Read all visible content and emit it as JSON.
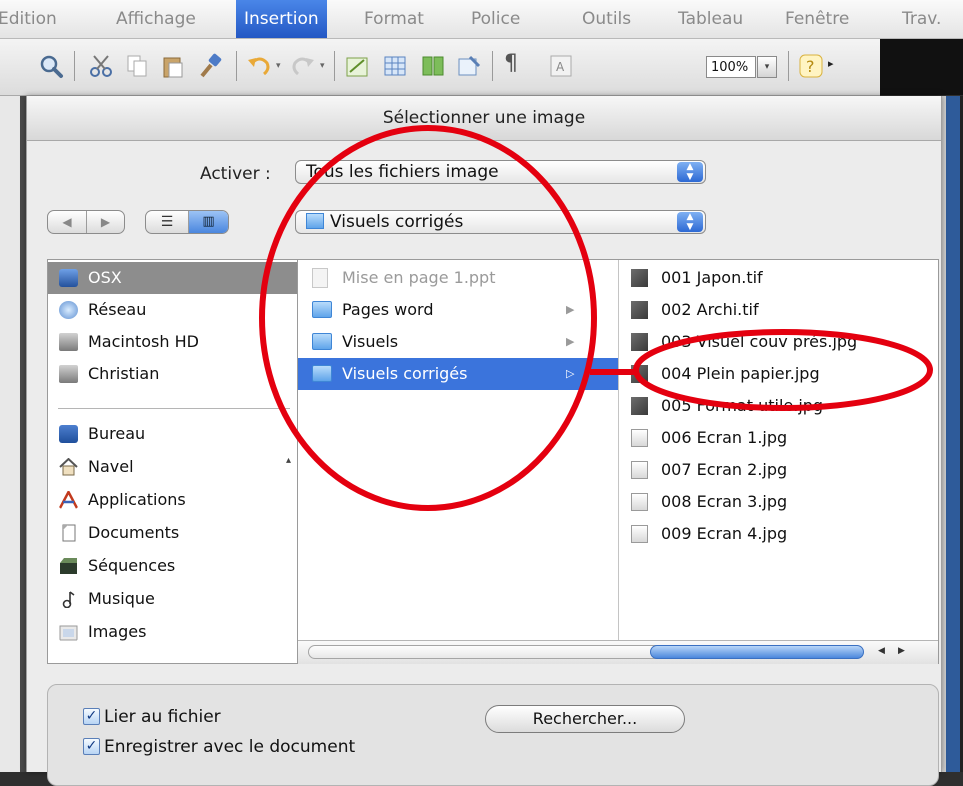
{
  "menubar": {
    "items": [
      {
        "label": "Edition",
        "active": false
      },
      {
        "label": "Affichage",
        "active": false
      },
      {
        "label": "Insertion",
        "active": true
      },
      {
        "label": "Format",
        "active": false
      },
      {
        "label": "Police",
        "active": false
      },
      {
        "label": "Outils",
        "active": false
      },
      {
        "label": "Tableau",
        "active": false
      },
      {
        "label": "Fenêtre",
        "active": false
      },
      {
        "label": "Trav.",
        "active": false
      }
    ]
  },
  "toolbar": {
    "zoom": "100%",
    "icons": [
      "zoom-icon",
      "cut-icon",
      "copy-icon",
      "paste-icon",
      "format-brush-icon",
      "undo-icon",
      "redo-icon",
      "drawing-icon",
      "table-icon",
      "columns-icon",
      "sidebar-icon",
      "pilcrow-icon",
      "text-box-icon",
      "help-icon"
    ]
  },
  "dialog": {
    "title": "Sélectionner une image",
    "activer_label": "Activer :",
    "filter_value": "Tous les fichiers image",
    "location_value": "Visuels corrigés",
    "sidebar": {
      "devices": [
        {
          "label": "OSX",
          "icon": "computer-icon",
          "selected": true
        },
        {
          "label": "Réseau",
          "icon": "network-icon",
          "selected": false
        },
        {
          "label": "Macintosh HD",
          "icon": "hard-drive-icon",
          "selected": false
        },
        {
          "label": "Christian",
          "icon": "hard-drive-icon",
          "selected": false
        }
      ],
      "places": [
        {
          "label": "Bureau",
          "icon": "desktop-icon"
        },
        {
          "label": "Navel",
          "icon": "home-icon"
        },
        {
          "label": "Applications",
          "icon": "applications-icon"
        },
        {
          "label": "Documents",
          "icon": "documents-icon"
        },
        {
          "label": "Séquences",
          "icon": "movies-icon"
        },
        {
          "label": "Musique",
          "icon": "music-icon"
        },
        {
          "label": "Images",
          "icon": "pictures-icon"
        }
      ]
    },
    "column1": [
      {
        "label": "Mise en page 1.ppt",
        "type": "file",
        "dim": true,
        "selected": false
      },
      {
        "label": "Pages word",
        "type": "folder",
        "dim": false,
        "selected": false
      },
      {
        "label": "Visuels",
        "type": "folder",
        "dim": false,
        "selected": false
      },
      {
        "label": "Visuels corrigés",
        "type": "folder",
        "dim": false,
        "selected": true
      }
    ],
    "column2": [
      {
        "label": "001 Japon.tif",
        "thumb": "dark"
      },
      {
        "label": "002 Archi.tif",
        "thumb": "dark"
      },
      {
        "label": "003 Visuel couv prés.jpg",
        "thumb": "dark"
      },
      {
        "label": "004 Plein papier.jpg",
        "thumb": "dark"
      },
      {
        "label": "005 Format utile.jpg",
        "thumb": "dark"
      },
      {
        "label": "006 Ecran 1.jpg",
        "thumb": "light"
      },
      {
        "label": "007 Ecran 2.jpg",
        "thumb": "light"
      },
      {
        "label": "008 Ecran 3.jpg",
        "thumb": "light"
      },
      {
        "label": "009 Ecran 4.jpg",
        "thumb": "light"
      }
    ],
    "options": {
      "link_label": "Lier au fichier",
      "link_checked": true,
      "save_label": "Enregistrer avec le document",
      "save_checked": true,
      "search_button": "Rechercher..."
    }
  },
  "colors": {
    "selection": "#3b74dc",
    "annotation": "#e4000f"
  }
}
